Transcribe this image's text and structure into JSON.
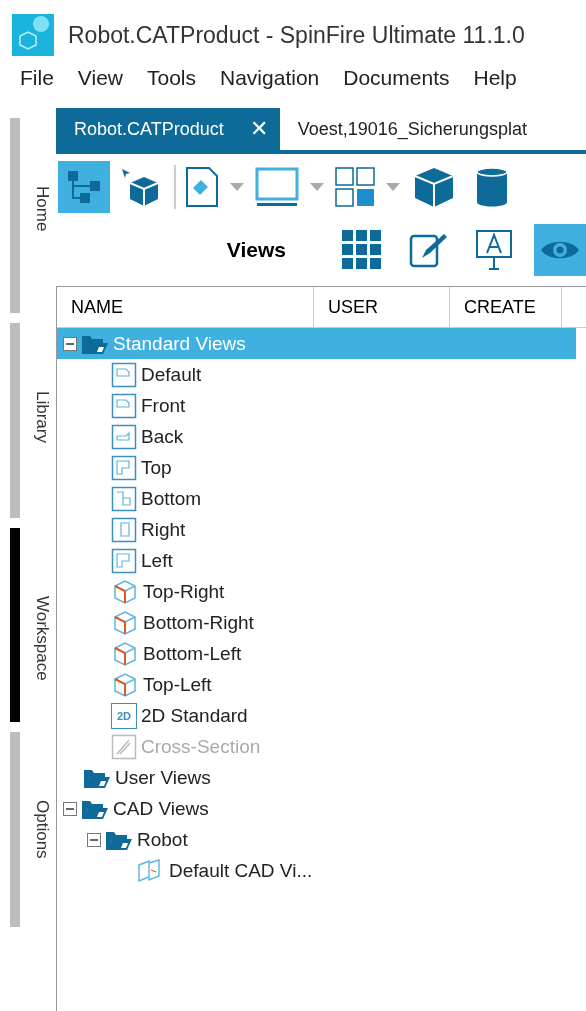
{
  "window": {
    "title": "Robot.CATProduct - SpinFire Ultimate 11.1.0"
  },
  "menu": [
    "File",
    "View",
    "Tools",
    "Navigation",
    "Documents",
    "Help"
  ],
  "side_tabs": [
    {
      "label": "Home",
      "selected": false
    },
    {
      "label": "Library",
      "selected": false
    },
    {
      "label": "Workspace",
      "selected": true
    },
    {
      "label": "Options",
      "selected": false
    }
  ],
  "doc_tabs": [
    {
      "label": "Robot.CATProduct",
      "selected": true,
      "close": "✕"
    },
    {
      "label": "Voest,19016_Sicherungsplat",
      "selected": false
    }
  ],
  "toolbar": [
    {
      "kind": "assembly",
      "selected": true,
      "dropdown": false
    },
    {
      "kind": "pick",
      "selected": false,
      "dropdown": false
    },
    {
      "kind": "paint",
      "selected": false,
      "dropdown": true
    },
    {
      "kind": "monitor",
      "selected": false,
      "dropdown": true
    },
    {
      "kind": "layout",
      "selected": false,
      "dropdown": true
    },
    {
      "kind": "cube",
      "selected": false,
      "dropdown": false
    },
    {
      "kind": "cylinder",
      "selected": false,
      "dropdown": false
    }
  ],
  "panel": {
    "title": "Views",
    "tools": [
      {
        "kind": "grid",
        "selected": false
      },
      {
        "kind": "edit",
        "selected": false
      },
      {
        "kind": "annotation",
        "selected": false
      },
      {
        "kind": "eye",
        "selected": true
      }
    ]
  },
  "table": {
    "columns": [
      "NAME",
      "USER",
      "CREATE"
    ],
    "tree": [
      {
        "label": "Standard Views",
        "kind": "folder",
        "expanded": true,
        "selected": true,
        "children": [
          {
            "label": "Default",
            "kind": "front",
            "disabled": false,
            "selected": false
          },
          {
            "label": "Front",
            "kind": "front",
            "disabled": false,
            "selected": false
          },
          {
            "label": "Back",
            "kind": "back",
            "disabled": false,
            "selected": false
          },
          {
            "label": "Top",
            "kind": "top",
            "disabled": false,
            "selected": false
          },
          {
            "label": "Bottom",
            "kind": "bottom",
            "disabled": false,
            "selected": false
          },
          {
            "label": "Right",
            "kind": "right",
            "disabled": false,
            "selected": false
          },
          {
            "label": "Left",
            "kind": "top",
            "disabled": false,
            "selected": false
          },
          {
            "label": "Top-Right",
            "kind": "iso",
            "disabled": false,
            "selected": false
          },
          {
            "label": "Bottom-Right",
            "kind": "iso",
            "disabled": false,
            "selected": false
          },
          {
            "label": "Bottom-Left",
            "kind": "iso",
            "disabled": false,
            "selected": false
          },
          {
            "label": "Top-Left",
            "kind": "iso",
            "disabled": false,
            "selected": false
          },
          {
            "label": "2D Standard",
            "kind": "badge",
            "badge": "2D",
            "disabled": false,
            "selected": false
          },
          {
            "label": "Cross-Section",
            "kind": "section",
            "disabled": true,
            "selected": false
          }
        ]
      },
      {
        "label": "User Views",
        "kind": "folder",
        "selected": false
      },
      {
        "label": "CAD Views",
        "kind": "folder",
        "expanded": true,
        "selected": false,
        "children": [
          {
            "label": "Robot",
            "kind": "folder",
            "expanded": true,
            "selected": false,
            "children": [
              {
                "label": "Default CAD Vi...",
                "kind": "cad",
                "disabled": false,
                "selected": false
              }
            ]
          }
        ]
      }
    ]
  }
}
